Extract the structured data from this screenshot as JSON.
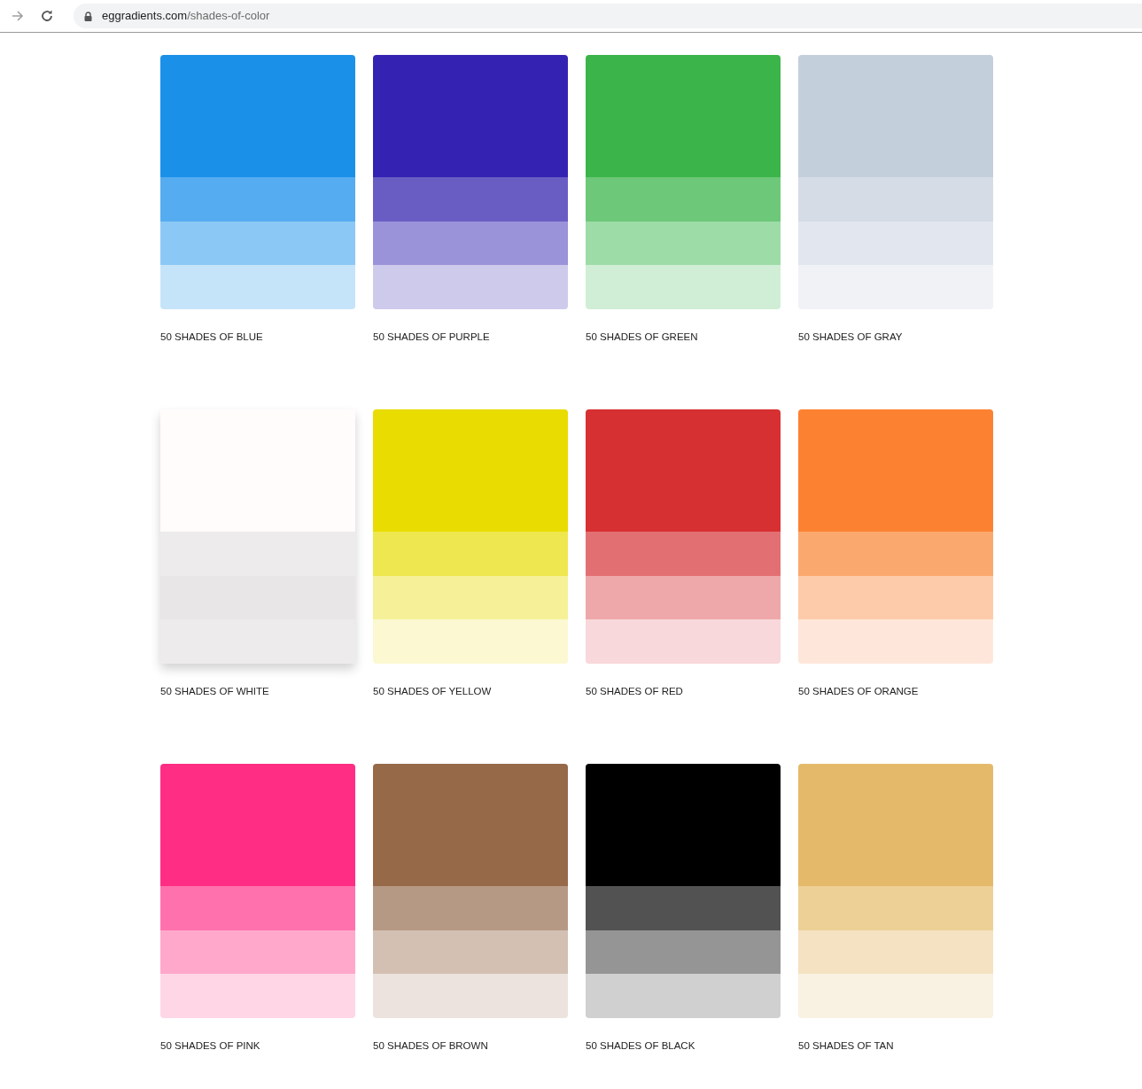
{
  "browser": {
    "url_host": "eggradients.com",
    "url_path": "/shades-of-color"
  },
  "cards": [
    {
      "label": "50 SHADES OF BLUE",
      "hovered": false,
      "swatches": [
        {
          "color": "#1b90e8"
        },
        {
          "color": "#55acf0"
        },
        {
          "color": "#8cc8f5"
        },
        {
          "color": "#c6e4f9"
        }
      ]
    },
    {
      "label": "50 SHADES OF PURPLE",
      "hovered": false,
      "swatches": [
        {
          "color": "#3423b3"
        },
        {
          "color": "#695dc4"
        },
        {
          "color": "#9a93d9"
        },
        {
          "color": "#cecaeb"
        }
      ]
    },
    {
      "label": "50 SHADES OF GREEN",
      "hovered": false,
      "swatches": [
        {
          "color": "#3bb54a"
        },
        {
          "color": "#6dc879"
        },
        {
          "color": "#9ddca7"
        },
        {
          "color": "#d0eed5"
        }
      ]
    },
    {
      "label": "50 SHADES OF GRAY",
      "hovered": false,
      "swatches": [
        {
          "color": "#c4cfdc"
        },
        {
          "color": "#d5dce5"
        },
        {
          "color": "#e2e7ef"
        },
        {
          "color": "#f1f2f5"
        }
      ]
    },
    {
      "label": "50 SHADES OF WHITE",
      "hovered": true,
      "swatches": [
        {
          "color": "#fffcfb"
        },
        {
          "color": "#edebeb"
        },
        {
          "color": "#e8e6e6"
        },
        {
          "color": "#edebeb"
        }
      ]
    },
    {
      "label": "50 SHADES OF YELLOW",
      "hovered": false,
      "swatches": [
        {
          "color": "#e8dc00"
        },
        {
          "color": "#efe74f"
        },
        {
          "color": "#f6f198"
        },
        {
          "color": "#fbf8d2"
        }
      ]
    },
    {
      "label": "50 SHADES OF RED",
      "hovered": false,
      "swatches": [
        {
          "color": "#d73032"
        },
        {
          "color": "#e27073"
        },
        {
          "color": "#eea8a9"
        },
        {
          "color": "#f8d8da"
        }
      ]
    },
    {
      "label": "50 SHADES OF ORANGE",
      "hovered": false,
      "swatches": [
        {
          "color": "#fc8232"
        },
        {
          "color": "#fba86e"
        },
        {
          "color": "#fdcba9"
        },
        {
          "color": "#fee7da"
        }
      ]
    },
    {
      "label": "50 SHADES OF PINK",
      "hovered": false,
      "swatches": [
        {
          "color": "#ff2d84"
        },
        {
          "color": "#ff71ac"
        },
        {
          "color": "#ffa8cb"
        },
        {
          "color": "#ffd6e6"
        }
      ]
    },
    {
      "label": "50 SHADES OF BROWN",
      "hovered": false,
      "swatches": [
        {
          "color": "#966949"
        },
        {
          "color": "#b69984"
        },
        {
          "color": "#d3c0b2"
        },
        {
          "color": "#ece3de"
        }
      ]
    },
    {
      "label": "50 SHADES OF BLACK",
      "hovered": false,
      "swatches": [
        {
          "color": "#000000"
        },
        {
          "color": "#525252"
        },
        {
          "color": "#959595"
        },
        {
          "color": "#d0d0d0"
        }
      ]
    },
    {
      "label": "50 SHADES OF TAN",
      "hovered": false,
      "swatches": [
        {
          "color": "#e4ba6a"
        },
        {
          "color": "#edd096"
        },
        {
          "color": "#f5e2c2"
        },
        {
          "color": "#f9f1e2"
        }
      ]
    }
  ]
}
